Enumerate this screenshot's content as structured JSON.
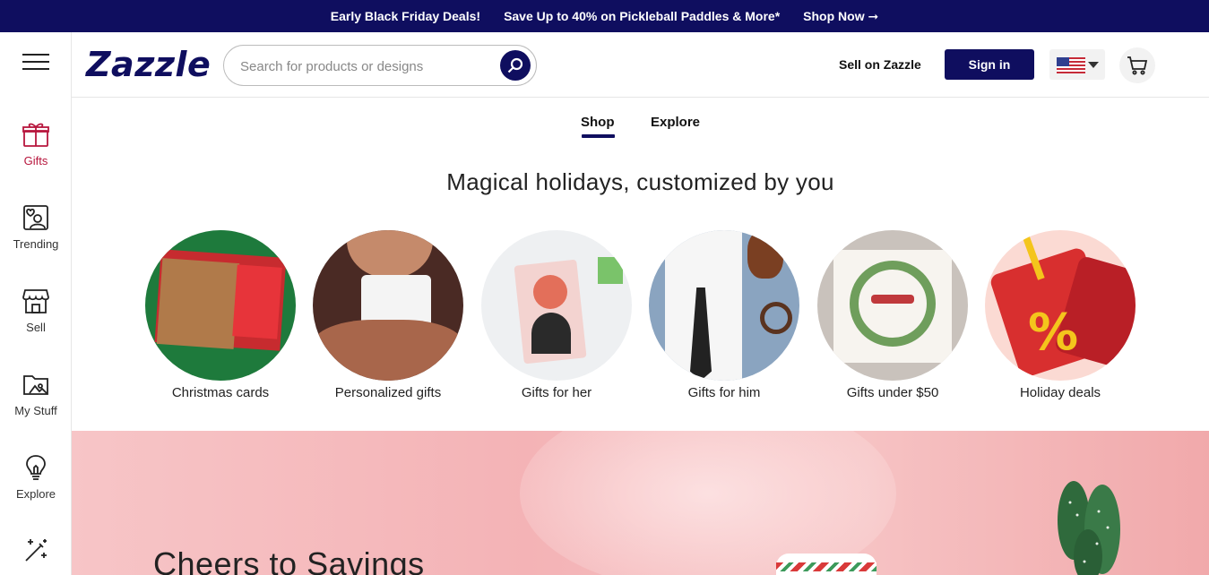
{
  "promo": {
    "deal_label": "Early Black Friday Deals!",
    "offer_text": "Save Up to 40% on Pickleball Paddles & More*",
    "cta": "Shop Now ➞"
  },
  "brand": {
    "logo_text": "Zazzle",
    "color": "#0f0e5f"
  },
  "search": {
    "placeholder": "Search for products or designs",
    "value": ""
  },
  "header": {
    "sell_link": "Sell on Zazzle",
    "sign_in": "Sign in",
    "country_flag": "us-flag-icon",
    "cart_icon": "cart-icon"
  },
  "sidebar": {
    "items": [
      {
        "label": "Gifts",
        "icon": "gift-icon",
        "active": true
      },
      {
        "label": "Trending",
        "icon": "trending-icon"
      },
      {
        "label": "Sell",
        "icon": "storefront-icon"
      },
      {
        "label": "My Stuff",
        "icon": "folder-icon"
      },
      {
        "label": "Explore",
        "icon": "lightbulb-icon"
      },
      {
        "label": "",
        "icon": "magic-wand-icon"
      }
    ],
    "active_color": "#b7163d"
  },
  "tabs": [
    {
      "label": "Shop",
      "active": true
    },
    {
      "label": "Explore",
      "active": false
    }
  ],
  "headline": "Magical holidays, customized by you",
  "categories": [
    {
      "label": "Christmas cards"
    },
    {
      "label": "Personalized gifts"
    },
    {
      "label": "Gifts for her"
    },
    {
      "label": "Gifts for him"
    },
    {
      "label": "Gifts under $50"
    },
    {
      "label": "Holiday deals"
    }
  ],
  "hero": {
    "title": "Cheers to Savings"
  }
}
